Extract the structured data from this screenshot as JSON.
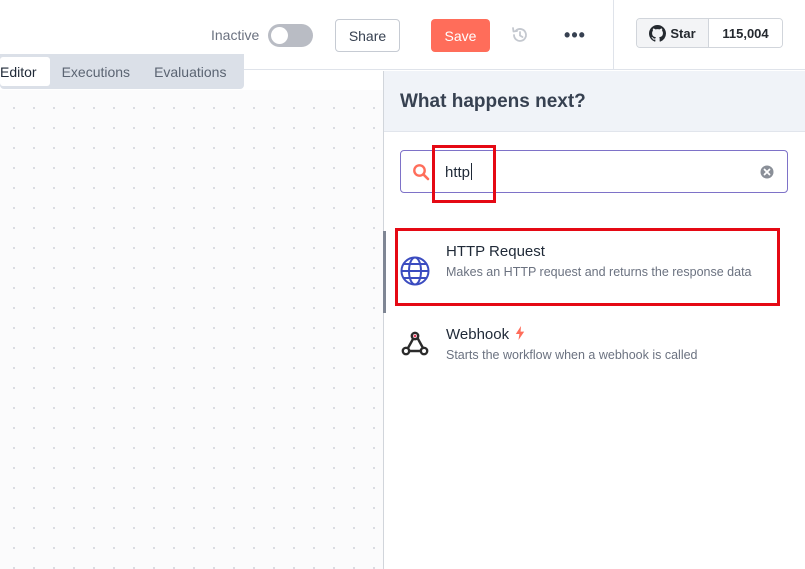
{
  "header": {
    "active_label": "Inactive",
    "share_label": "Share",
    "save_label": "Save",
    "more_label": "•••",
    "github": {
      "star_label": "Star",
      "star_count": "115,004"
    }
  },
  "tabs": [
    {
      "label": "Editor",
      "active": true
    },
    {
      "label": "Executions",
      "active": false
    },
    {
      "label": "Evaluations",
      "active": false
    }
  ],
  "panel": {
    "title": "What happens next?",
    "search": {
      "value": "http"
    },
    "results": [
      {
        "title": "HTTP Request",
        "description": "Makes an HTTP request and returns the response data",
        "icon": "globe-icon",
        "selected": true
      },
      {
        "title": "Webhook",
        "description": "Starts the workflow when a webhook is called",
        "icon": "webhook-icon",
        "trigger": true,
        "selected": false
      }
    ]
  },
  "colors": {
    "accent": "#ff6d5a",
    "search_border": "#7e72c8",
    "annotation": "#e50914",
    "globe": "#3b4cc0"
  }
}
